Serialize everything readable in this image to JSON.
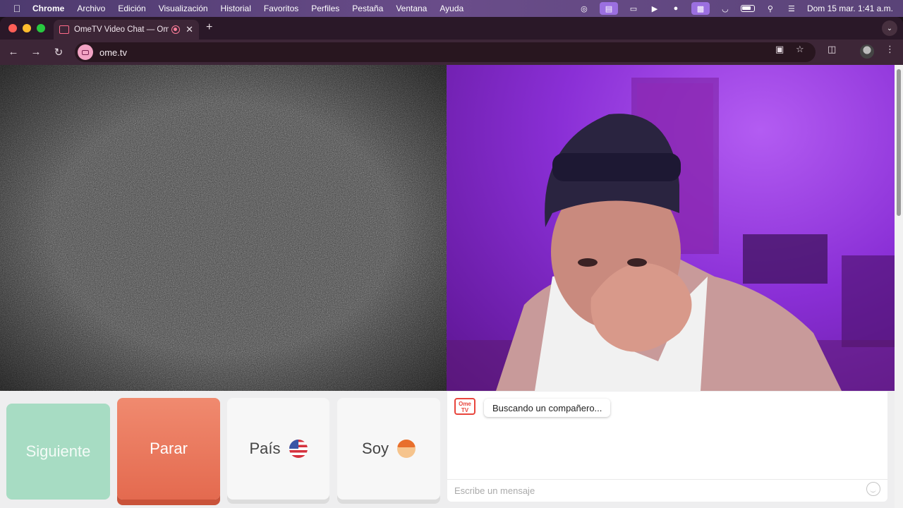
{
  "menubar": {
    "app": "Chrome",
    "items": [
      "Archivo",
      "Edición",
      "Visualización",
      "Historial",
      "Favoritos",
      "Perfiles",
      "Pestaña",
      "Ventana",
      "Ayuda"
    ],
    "clock": "Dom 15 mar.  1:41 a.m."
  },
  "browser": {
    "tab_title": "OmeTV Video Chat — Ome",
    "url": "ome.tv"
  },
  "controls": {
    "next_label": "Siguiente",
    "stop_label": "Parar",
    "country_label": "País",
    "me_label": "Soy"
  },
  "chat": {
    "logo_text": "Ome TV",
    "status": "Buscando un compañero...",
    "input_placeholder": "Escribe un mensaje"
  },
  "colors": {
    "stop": "#e46a4f",
    "next": "#a7dcc3",
    "camera_bg": "#8a2fd6"
  }
}
